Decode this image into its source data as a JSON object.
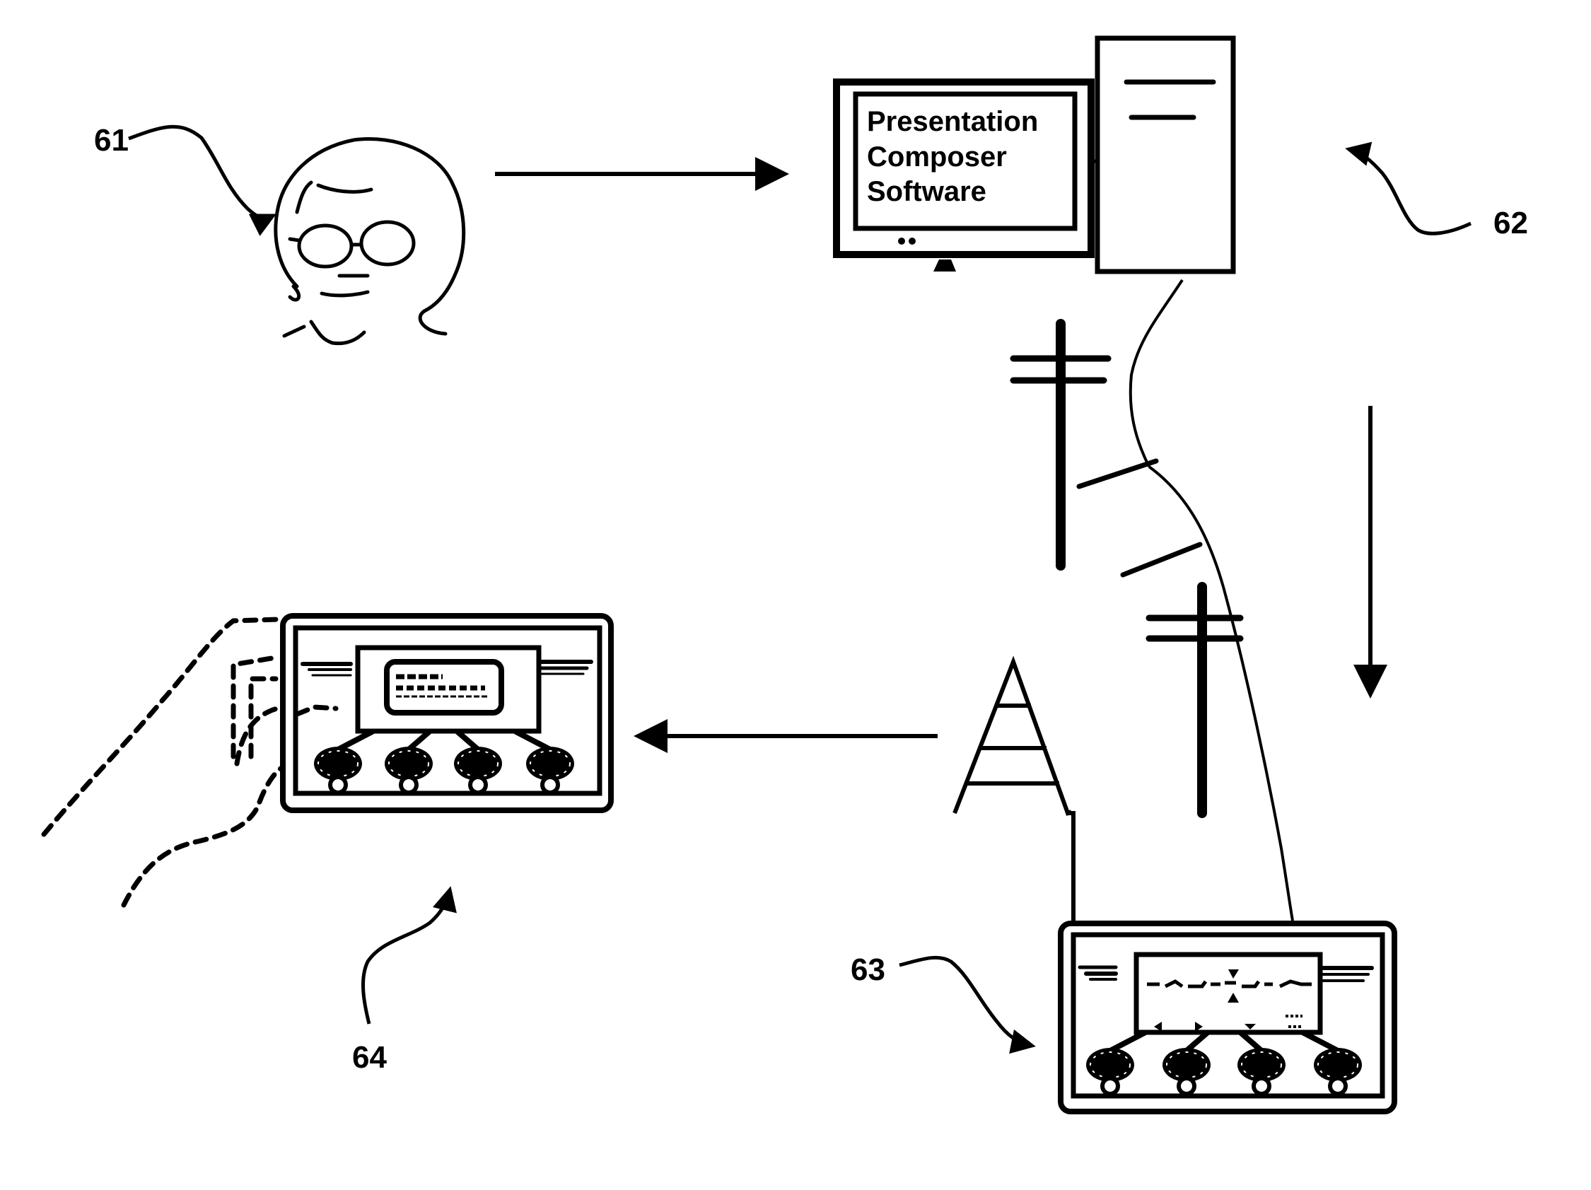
{
  "figure": {
    "type": "patent-style system diagram",
    "colors": {
      "ink": "#000000",
      "background": "#ffffff"
    }
  },
  "components": {
    "author": {
      "ref": "61",
      "depicts": "person-with-glasses-icon"
    },
    "workstation": {
      "ref": "62",
      "screen_lines": [
        "Presentation",
        "Composer",
        "Software"
      ],
      "depicts": "desktop-computer-icon"
    },
    "network": {
      "depicts": [
        "utility-pole-icon",
        "utility-pole-icon",
        "radio-tower-icon",
        "cable-line"
      ]
    },
    "authoring_device": {
      "ref": "63",
      "depicts": "handheld-device-icon",
      "screen": "waveform-editor"
    },
    "playback_device": {
      "ref": "64",
      "depicts": "handheld-device-icon",
      "screen": "text-message",
      "held_by": "hand-outline-icon"
    }
  },
  "flow_arrows": [
    {
      "from": "author",
      "to": "workstation",
      "direction": "right"
    },
    {
      "from": "workstation",
      "to": "authoring_device",
      "direction": "down"
    },
    {
      "from": "authoring_device",
      "to": "playback_device",
      "direction": "left"
    }
  ]
}
